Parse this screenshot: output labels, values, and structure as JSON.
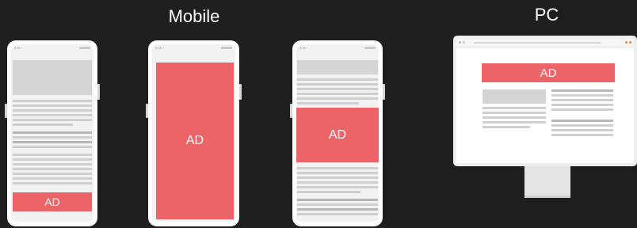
{
  "headings": {
    "mobile": "Mobile",
    "pc": "PC"
  },
  "phones": [
    {
      "status_time": "9:59 ⁃",
      "ad_label": "AD",
      "ad_placement": "bottom"
    },
    {
      "status_time": "9:59 ⁃",
      "ad_label": "AD",
      "ad_placement": "full-screen"
    },
    {
      "status_time": "9:59 ⁃",
      "ad_label": "AD",
      "ad_placement": "in-content"
    }
  ],
  "pc": {
    "ad_label": "AD",
    "ad_placement": "top-banner"
  },
  "colors": {
    "background": "#1e1e1e",
    "ad": "#ec6468",
    "placeholder": "#cfcfcf",
    "device": "#ffffff"
  }
}
